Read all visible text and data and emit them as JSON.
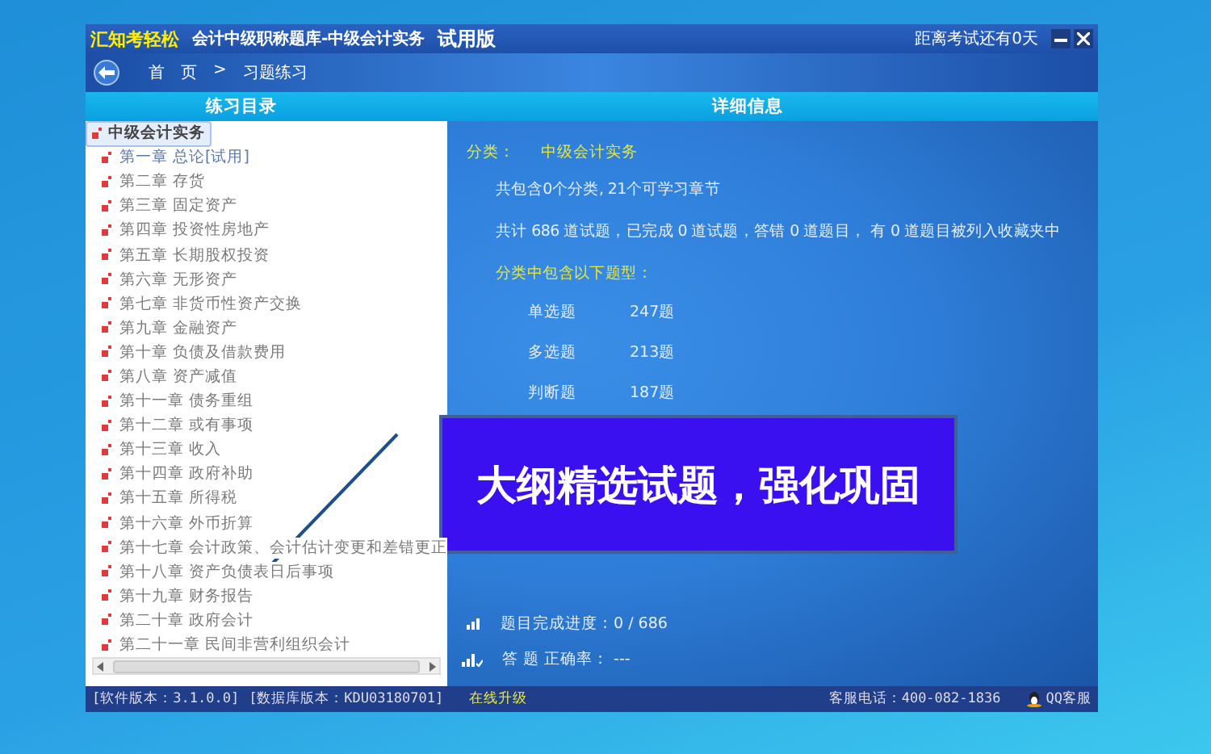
{
  "window": {
    "title_logo": "汇知考轻松",
    "title": "会计中级职称题库-中级会计实务",
    "edition": "试用版",
    "countdown": "距离考试还有0天"
  },
  "breadcrumb": {
    "home": "首　页",
    "separator": ">",
    "current": "习题练习"
  },
  "headers": {
    "left": "练习目录",
    "right": "详细信息"
  },
  "tree": {
    "label": "中级会计实务",
    "selected": true,
    "expanded": true,
    "children": [
      {
        "label": "第一章 总论[试用]",
        "kind": "trial",
        "selected": false
      },
      {
        "label": "第二章 存货",
        "kind": "locked",
        "selected": false
      },
      {
        "label": "第三章 固定资产",
        "kind": "locked",
        "selected": false
      },
      {
        "label": "第四章 投资性房地产",
        "kind": "locked",
        "selected": false
      },
      {
        "label": "第五章 长期股权投资",
        "kind": "locked",
        "selected": false
      },
      {
        "label": "第六章 无形资产",
        "kind": "locked",
        "selected": false
      },
      {
        "label": "第七章 非货币性资产交换",
        "kind": "locked",
        "selected": false
      },
      {
        "label": "第九章 金融资产",
        "kind": "locked",
        "selected": false
      },
      {
        "label": "第十章 负债及借款费用",
        "kind": "locked",
        "selected": false
      },
      {
        "label": "第八章 资产减值",
        "kind": "locked",
        "selected": false
      },
      {
        "label": "第十一章 债务重组",
        "kind": "locked",
        "selected": false
      },
      {
        "label": "第十二章 或有事项",
        "kind": "locked",
        "selected": false
      },
      {
        "label": "第十三章 收入",
        "kind": "locked",
        "selected": false
      },
      {
        "label": "第十四章 政府补助",
        "kind": "locked",
        "selected": false
      },
      {
        "label": "第十五章 所得税",
        "kind": "locked",
        "selected": false
      },
      {
        "label": "第十六章 外币折算",
        "kind": "locked",
        "selected": false
      },
      {
        "label": "第十七章 会计政策、会计估计变更和差错更正",
        "kind": "locked",
        "selected": false
      },
      {
        "label": "第十八章 资产负债表日后事项",
        "kind": "locked",
        "selected": false
      },
      {
        "label": "第十九章 财务报告",
        "kind": "locked",
        "selected": false
      },
      {
        "label": "第二十章 政府会计",
        "kind": "locked",
        "selected": false
      },
      {
        "label": "第二十一章 民间非营利组织会计",
        "kind": "locked",
        "selected": false
      }
    ]
  },
  "detail": {
    "category_label": "分类：",
    "category": "中级会计实务",
    "summary": "共包含0个分类, 21个可学习章节",
    "totals": "共计 686 道试题，已完成 0 道试题，答错 0 道题目， 有 0 道题目被列入收藏夹中",
    "types_heading": "分类中包含以下题型：",
    "types": [
      {
        "name": "单选题",
        "count": "247题"
      },
      {
        "name": "多选题",
        "count": "213题"
      },
      {
        "name": "判断题",
        "count": "187题"
      }
    ],
    "progress": "题目完成进度：0 / 686",
    "accuracy": "答 题 正确率： ---"
  },
  "banner": "大纲精选试题，强化巩固",
  "status_bar": {
    "software_version": "[软件版本：3.1.0.0]",
    "database_version": "[数据库版本：KDU03180701]",
    "upgrade_link": "在线升级",
    "hotline": "客服电话：400-082-1836",
    "qq_service": "QQ客服"
  }
}
